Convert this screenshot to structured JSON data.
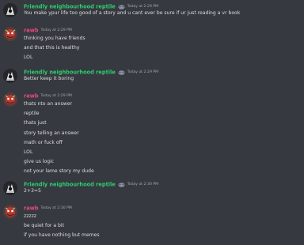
{
  "colors": {
    "background": "#36393f",
    "reptile_name": "#2ecc71",
    "rawb_name": "#e84a7a",
    "text": "#dcddde",
    "timestamp": "#a3a6aa"
  },
  "messages": [
    {
      "author": "Friendly neighbourhood reptile",
      "author_color": "#2ecc71",
      "avatar_icon": "reptile-avatar-icon",
      "badge_icon": "pet-emoji-icon",
      "timestamp": "Today at 2:29 PM",
      "lines": [
        "You make ypur life too good of a story and u cant ever be sure if ur just reading a vr book"
      ]
    },
    {
      "author": "rawb",
      "author_color": "#e84a7a",
      "avatar_icon": "rawb-avatar-icon",
      "timestamp": "Today at 2:29 PM",
      "lines": [
        "thinking you have friends",
        "and that this is healthy",
        "LOL"
      ]
    },
    {
      "author": "Friendly neighbourhood reptile",
      "author_color": "#2ecc71",
      "avatar_icon": "reptile-avatar-icon",
      "badge_icon": "pet-emoji-icon",
      "timestamp": "Today at 2:29 PM",
      "lines": [
        "Better keep it boring"
      ]
    },
    {
      "author": "rawb",
      "author_color": "#e84a7a",
      "avatar_icon": "rawb-avatar-icon",
      "timestamp": "Today at 2:29 PM",
      "lines": [
        "thats nto an answer",
        "reptile",
        "thats just",
        "story telling an answer",
        "math or fuck off",
        "LOL",
        "give us logic",
        "not your lame story my dude"
      ]
    },
    {
      "author": "Friendly neighbourhood reptile",
      "author_color": "#2ecc71",
      "avatar_icon": "reptile-avatar-icon",
      "badge_icon": "pet-emoji-icon",
      "timestamp": "Today at 2:30 PM",
      "lines": [
        "2+3=5"
      ]
    },
    {
      "author": "rawb",
      "author_color": "#e84a7a",
      "avatar_icon": "rawb-avatar-icon",
      "timestamp": "Today at 2:30 PM",
      "lines": [
        "zzzzz",
        "be quiet for a bit",
        "if you have nothing but memes"
      ]
    }
  ]
}
